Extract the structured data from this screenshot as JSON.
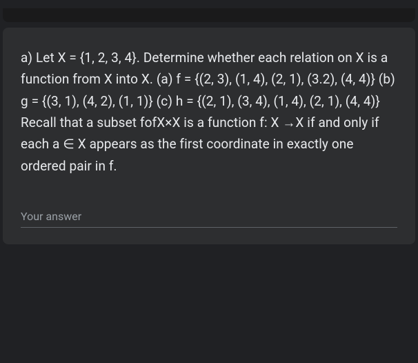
{
  "question": {
    "text": "a) Let X = {1, 2, 3, 4}. Determine whether each relation on X is a function from X into X. (a) f = {(2, 3), (1, 4), (2, 1), (3.2), (4, 4)} (b) g = {(3, 1), (4, 2), (1, 1)} (c) h = {(2, 1), (3, 4), (1, 4), (2, 1), (4, 4)} Recall that a subset fofX×X is a function f: X →X if and only if each a ∈ X appears as the first coordinate in exactly one ordered pair in f."
  },
  "answer": {
    "placeholder": "Your answer",
    "value": ""
  }
}
